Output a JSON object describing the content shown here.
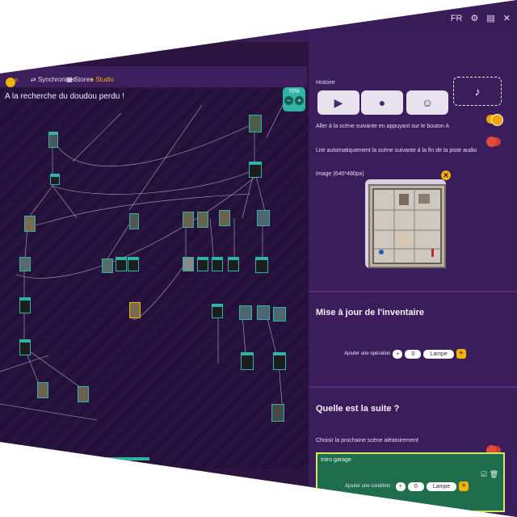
{
  "titlebar": {
    "lang": "FR",
    "gear_icon": "gear-icon",
    "book_icon": "book-icon",
    "close_icon": "close-icon"
  },
  "toolbar": {
    "undo_icon": "undo-icon",
    "redo_icon": "redo-icon",
    "toolbox_icon": "toolbox-icon",
    "play_icon": "play-icon",
    "save_icon": "save-icon",
    "close_icon": "close-icon"
  },
  "menu": {
    "sync_label": "Synchroniser",
    "stores_label": "Stores",
    "studio_label": "Studio"
  },
  "graph": {
    "title": "A la recherche du doudou perdu !",
    "zoom_value": "70%"
  },
  "panel": {
    "section_label": "Histoire",
    "types": [
      {
        "name": "play",
        "icon": "play-icon"
      },
      {
        "name": "mic",
        "icon": "microphone-icon"
      },
      {
        "name": "robot",
        "icon": "robot-icon"
      },
      {
        "name": "music",
        "icon": "music-note-icon"
      }
    ],
    "option1": "Aller à la scène suivante en appuyant sur le bouton A",
    "option2": "Lire automatiquement la scène suivante à la fin de la piste audio",
    "image_label": "Image (640*480px)",
    "toggle1_color": "#f0a400",
    "toggle2_color": "#e04a3a"
  },
  "inventory": {
    "title": "Mise à jour de l'inventaire",
    "op_label": "Ajouter une opération",
    "op_sign": "+",
    "op_value": "0",
    "op_item": "Lampe",
    "add": "+"
  },
  "next": {
    "title": "Quelle est la suite ?",
    "choice_label": "Choisir la prochaine scène aléatoirement",
    "scene_name": "Intro garage",
    "cond_label": "Ajouter une condition :",
    "cond_sign": "+",
    "cond_value": "0",
    "cond_item": "Lampe",
    "add": "+"
  }
}
